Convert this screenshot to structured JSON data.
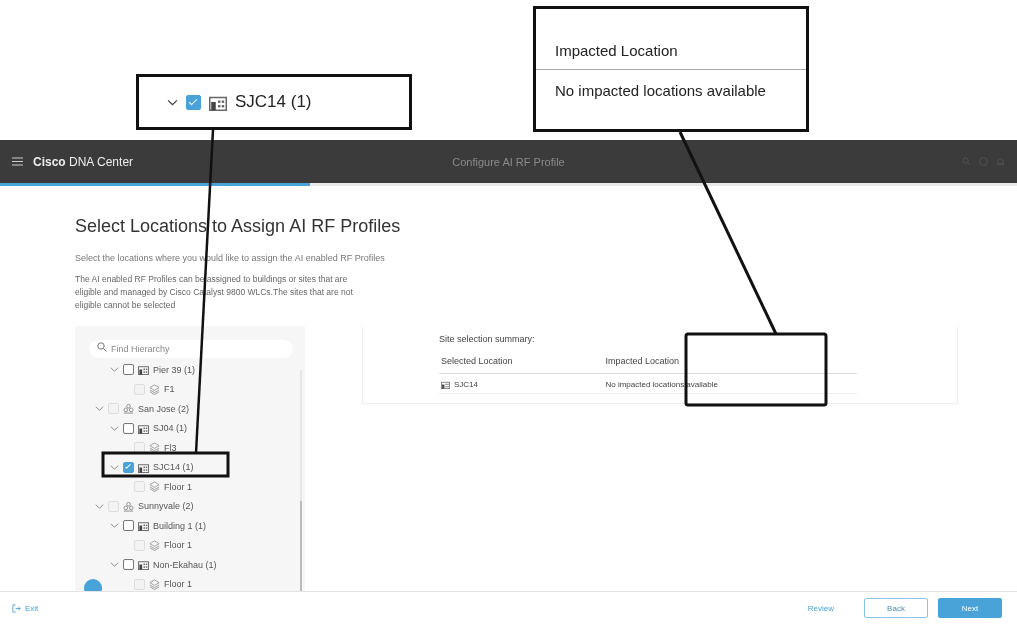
{
  "callouts": {
    "tree_item": {
      "label": "SJC14 (1)",
      "checked": true,
      "expanded": true
    },
    "impacted": {
      "header": "Impacted Location",
      "value": "No impacted locations available"
    }
  },
  "header": {
    "brand": "**Cisco** DNA Center",
    "title": "Configure AI RF Profile"
  },
  "progress": {
    "level": 0.305
  },
  "page": {
    "title": "Select Locations to Assign AI RF Profiles",
    "intro": "Select the locations where you would like to assign the AI enabled RF Profiles",
    "note": "The AI enabled RF Profiles can be assigned to buildings or sites that are eligible and managed by Cisco Catalyst 9800 WLCs.The sites that are not eligible cannot be selected"
  },
  "tree": {
    "search_placeholder": "Find Hierarchy",
    "items": [
      {
        "kind": "building",
        "label": "Pier 39 (1)",
        "checked": false,
        "disabled": false,
        "expanded": true,
        "children": [
          {
            "kind": "floor",
            "label": "F1",
            "checked": false,
            "disabled": true
          }
        ]
      },
      {
        "kind": "area",
        "label": "San Jose (2)",
        "checked": false,
        "disabled": true,
        "expanded": true,
        "children": [
          {
            "kind": "building",
            "label": "SJ04 (1)",
            "checked": false,
            "disabled": false,
            "expanded": true,
            "children": [
              {
                "kind": "floor",
                "label": "Fl3",
                "checked": false,
                "disabled": true
              }
            ]
          },
          {
            "kind": "building",
            "label": "SJC14 (1)",
            "checked": true,
            "disabled": false,
            "expanded": true,
            "children": [
              {
                "kind": "floor",
                "label": "Floor 1",
                "checked": false,
                "disabled": true
              }
            ]
          }
        ]
      },
      {
        "kind": "area",
        "label": "Sunnyvale (2)",
        "checked": false,
        "disabled": true,
        "expanded": true,
        "children": [
          {
            "kind": "building",
            "label": "Building 1 (1)",
            "checked": false,
            "disabled": false,
            "expanded": true,
            "children": [
              {
                "kind": "floor",
                "label": "Floor 1",
                "checked": false,
                "disabled": true
              }
            ]
          },
          {
            "kind": "building",
            "label": "Non-Ekahau (1)",
            "checked": false,
            "disabled": false,
            "expanded": true,
            "children": [
              {
                "kind": "floor",
                "label": "Floor 1",
                "checked": false,
                "disabled": true
              }
            ]
          }
        ]
      }
    ]
  },
  "summary": {
    "title": "Site selection summary:",
    "columns": [
      "Selected Location",
      "Impacted Location"
    ],
    "rows": [
      {
        "location": "SJC14",
        "impacted": "No impacted locations available"
      }
    ]
  },
  "footer": {
    "exit": "Exit",
    "buttons": [
      {
        "label": "Review",
        "kind": "link"
      },
      {
        "label": "Back",
        "kind": "secondary"
      },
      {
        "label": "Next",
        "kind": "primary"
      }
    ]
  }
}
